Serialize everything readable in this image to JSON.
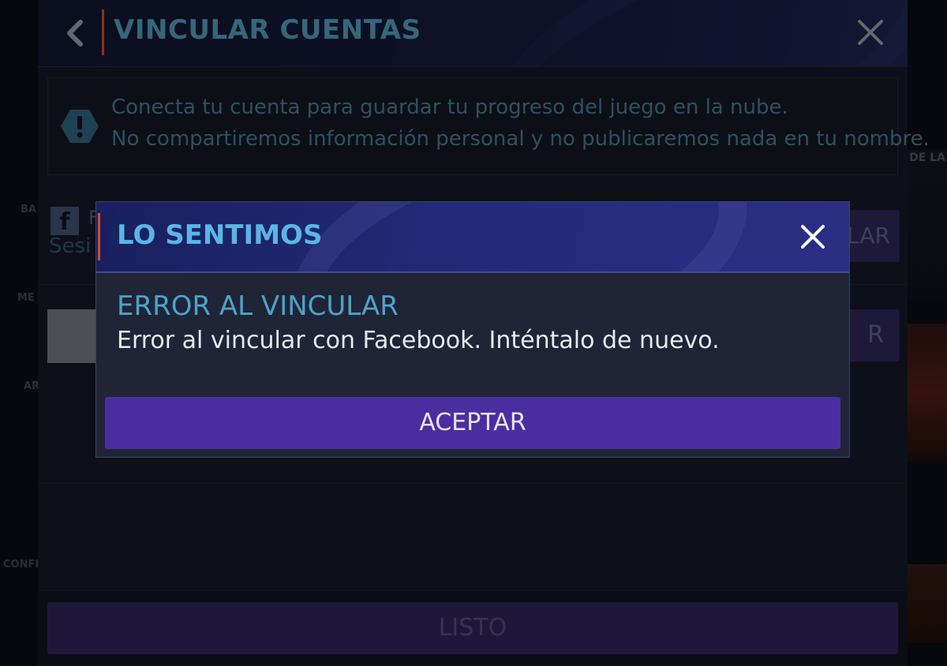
{
  "panel": {
    "title": "VINCULAR CUENTAS",
    "info_line1": "Conecta tu cuenta para guardar tu progreso del juego en la nube.",
    "info_line2": "No compartiremos información personal y no publicaremos nada en tu nombre.",
    "facebook_name": "F",
    "facebook_sub": "Sesi",
    "link_button_partial": "LAR",
    "link_button2_partial": "R",
    "done_label": "LISTO"
  },
  "background": {
    "frag_right": "DE LA",
    "frag_ba": "BA",
    "frag_me": "ME",
    "frag_ar": "AR",
    "frag_conf": "CONFI"
  },
  "modal": {
    "title": "LO SENTIMOS",
    "subtitle": "ERROR AL VINCULAR",
    "message": "Error al vincular con Facebook. Inténtalo de nuevo.",
    "accept_label": "ACEPTAR"
  },
  "colors": {
    "accent_red": "#d04a3a",
    "title_blue": "#59b6e6",
    "button_purple": "#4a2ea0"
  },
  "icons": {
    "back": "chevron-left-icon",
    "close": "close-icon",
    "info": "exclamation-hexagon-icon",
    "facebook": "facebook-icon"
  }
}
